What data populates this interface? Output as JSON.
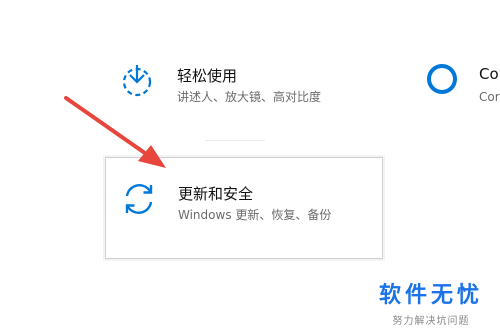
{
  "colors": {
    "accent": "#0078d7",
    "arrow": "#e8453c",
    "watermark": "#1a73e8"
  },
  "tiles": {
    "ease": {
      "icon": "ease-of-access-icon",
      "title": "轻松使用",
      "subtitle": "讲述人、放大镜、高对比度"
    },
    "cortana": {
      "icon": "cortana-icon",
      "title": "Cortana",
      "subtitle": "Cortana 语言、权限、通知"
    },
    "update": {
      "icon": "sync-icon",
      "title": "更新和安全",
      "subtitle": "Windows 更新、恢复、备份"
    }
  },
  "annotation": {
    "icon": "red-pointer-arrow"
  },
  "watermark": {
    "logo": "软件无忧",
    "slogan": "努力解决坑问题"
  }
}
